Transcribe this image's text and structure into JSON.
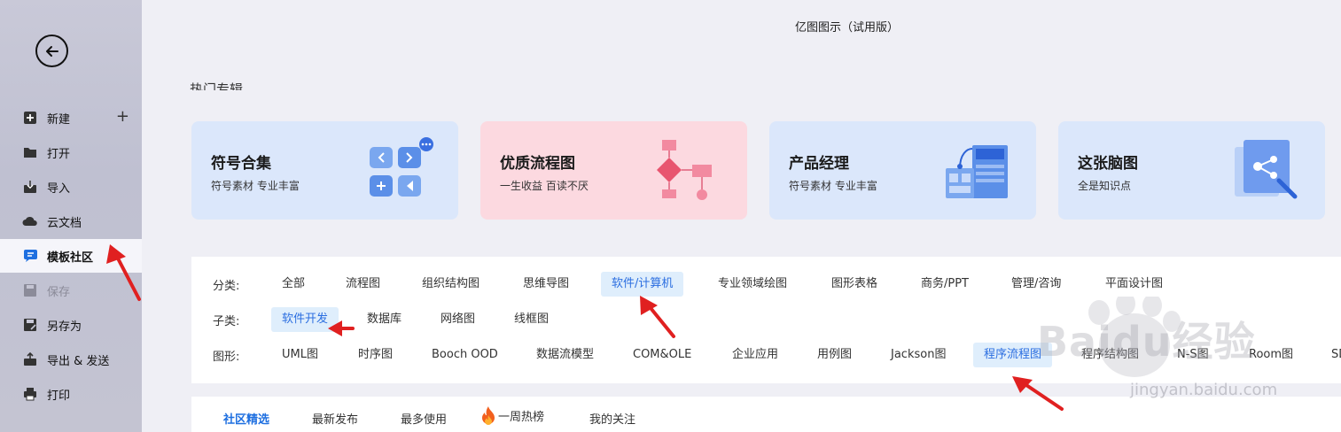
{
  "app": {
    "title": "亿图图示（试用版）"
  },
  "sidebar": {
    "items": [
      {
        "label": "新建",
        "icon": "plus-square-icon"
      },
      {
        "label": "打开",
        "icon": "folder-icon"
      },
      {
        "label": "导入",
        "icon": "import-icon"
      },
      {
        "label": "云文档",
        "icon": "cloud-icon"
      },
      {
        "label": "模板社区",
        "icon": "template-community-icon",
        "active": true
      },
      {
        "label": "保存",
        "icon": "save-icon",
        "disabled": true
      },
      {
        "label": "另存为",
        "icon": "save-as-icon"
      },
      {
        "label": "导出 & 发送",
        "icon": "export-icon"
      },
      {
        "label": "打印",
        "icon": "printer-icon"
      }
    ],
    "plus_symbol": "+"
  },
  "section": {
    "heading": "热门专辑"
  },
  "cards": [
    {
      "title": "符号合集",
      "subtitle": "符号素材 专业丰富"
    },
    {
      "title": "优质流程图",
      "subtitle": "一生收益 百读不厌"
    },
    {
      "title": "产品经理",
      "subtitle": "符号素材 专业丰富"
    },
    {
      "title": "这张脑图",
      "subtitle": "全是知识点"
    }
  ],
  "filters": {
    "category_label": "分类:",
    "categories": [
      "全部",
      "流程图",
      "组织结构图",
      "思维导图",
      "软件/计算机",
      "专业领域绘图",
      "图形表格",
      "商务/PPT",
      "管理/咨询",
      "平面设计图"
    ],
    "category_selected": "软件/计算机",
    "subcategory_label": "子类:",
    "subcategories": [
      "软件开发",
      "数据库",
      "网络图",
      "线框图"
    ],
    "subcategory_selected": "软件开发",
    "shape_label": "图形:",
    "shapes": [
      "UML图",
      "时序图",
      "Booch OOD",
      "数据流模型",
      "COM&OLE",
      "企业应用",
      "用例图",
      "Jackson图",
      "程序流程图",
      "程序结构图",
      "N-S图",
      "Room图",
      "SDL图"
    ],
    "shape_selected": "程序流程图"
  },
  "tabs": [
    {
      "label": "社区精选",
      "selected": true
    },
    {
      "label": "最新发布"
    },
    {
      "label": "最多使用"
    },
    {
      "label": "一周热榜",
      "icon": "fire-icon"
    },
    {
      "label": "我的关注"
    }
  ],
  "watermark": {
    "brand": "Baidu经验",
    "url": "jingyan.baidu.com"
  },
  "colors": {
    "accent": "#1e6fe0",
    "chip_selected_bg": "#dfeefc",
    "card_blue": "#dbe7fb",
    "card_pink": "#fcd9e0",
    "arrow_red": "#e02020"
  }
}
